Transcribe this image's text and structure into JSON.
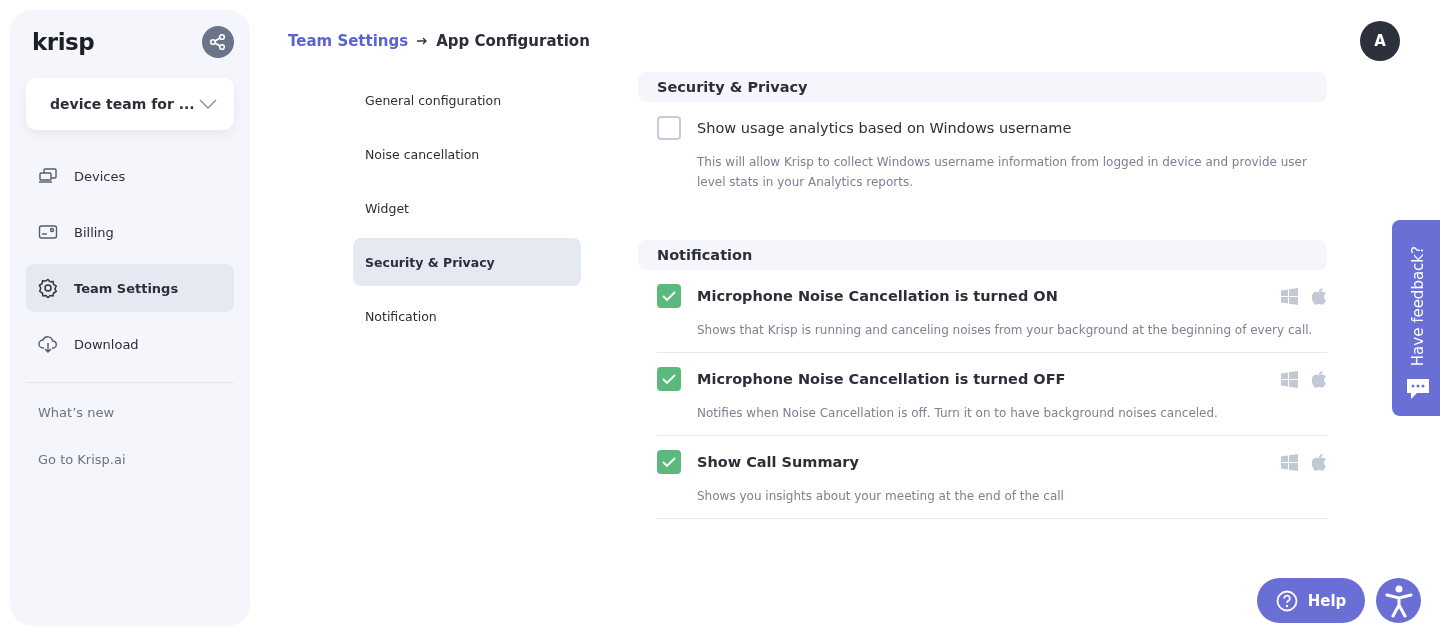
{
  "sidebar": {
    "logo": "krisp",
    "team_select": "device team for ...",
    "items": [
      {
        "label": "Devices",
        "kind": "devices",
        "selected": false
      },
      {
        "label": "Billing",
        "kind": "billing",
        "selected": false
      },
      {
        "label": "Team Settings",
        "kind": "settings",
        "selected": true
      },
      {
        "label": "Download",
        "kind": "download",
        "selected": false
      }
    ],
    "links": [
      "What’s new",
      "Go to Krisp.ai"
    ]
  },
  "breadcrumb": {
    "parent": "Team Settings",
    "current": "App Configuration"
  },
  "avatar": "A",
  "subnav": [
    {
      "label": "General configuration",
      "selected": false
    },
    {
      "label": "Noise cancellation",
      "selected": false
    },
    {
      "label": "Widget",
      "selected": false
    },
    {
      "label": "Security & Privacy",
      "selected": true
    },
    {
      "label": "Notification",
      "selected": false
    }
  ],
  "sections": [
    {
      "title": "Security & Privacy",
      "options": [
        {
          "label": "Show usage analytics based on Windows username",
          "description": "This will allow Krisp to collect Windows username information from logged in device and provide user level stats in your Analytics reports.",
          "checked": false,
          "platforms": false,
          "bold": false
        }
      ]
    },
    {
      "title": "Notification",
      "options": [
        {
          "label": "Microphone Noise Cancellation is turned ON",
          "description": "Shows that Krisp is running and canceling noises from your background at the beginning of every call.",
          "checked": true,
          "platforms": true,
          "bold": true
        },
        {
          "label": "Microphone Noise Cancellation is turned OFF",
          "description": "Notifies when Noise Cancellation is off. Turn it on to have background noises canceled.",
          "checked": true,
          "platforms": true,
          "bold": true
        },
        {
          "label": "Show Call Summary",
          "description": "Shows you insights about your meeting at the end of the call",
          "checked": true,
          "platforms": true,
          "bold": true
        }
      ]
    }
  ],
  "feedback": "Have feedback?",
  "help": "Help"
}
